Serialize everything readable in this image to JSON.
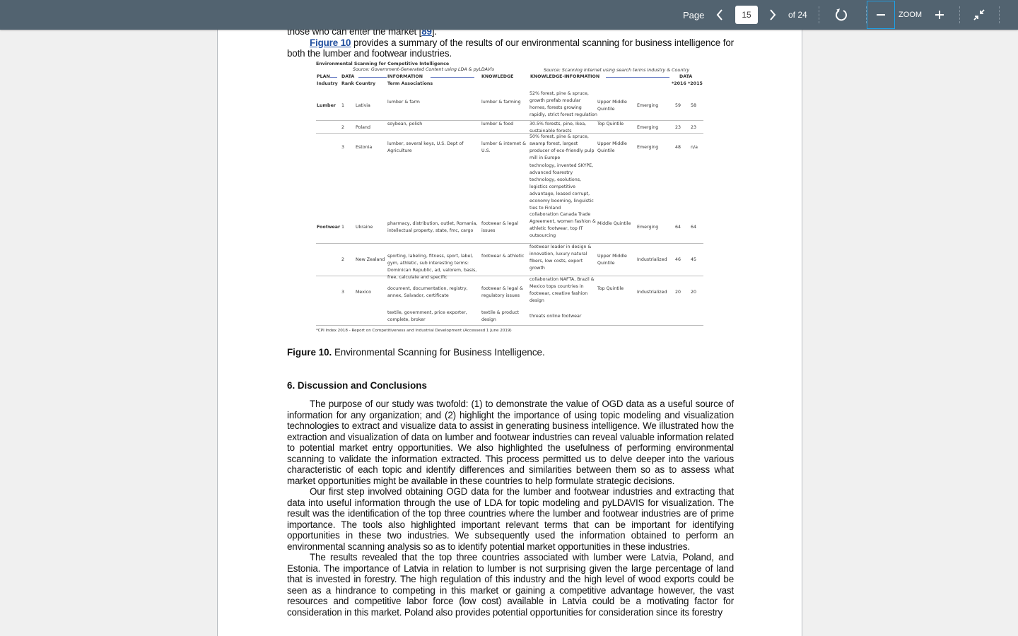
{
  "toolbar": {
    "page_label": "Page",
    "current_page": "15",
    "total_pages": "of 24",
    "zoom_label": "ZOOM",
    "icons": {
      "prev": "chevron-left-icon",
      "next": "chevron-right-icon",
      "rotate": "rotate-icon",
      "zoom_out": "minus-icon",
      "zoom_in": "plus-icon",
      "fit": "collapse-icon"
    },
    "colors": {
      "bar": "#526370",
      "focus": "#1ea0e6"
    }
  },
  "document": {
    "intro_line_pre": "those who can enter the market [",
    "intro_cite": "89",
    "intro_line_post": "].",
    "fig_ref_link": "Figure 10",
    "fig_ref_text": " provides a summary of the results of our environmental scanning for business intelligence for both the lumber and footwear industries.",
    "figure": {
      "title": "Environmental Scanning for Competitive Intelligence",
      "source_left": "Source:  Government-Generated Content using LDA & pyLDAVis",
      "source_right": "Source:  Scanning internet using search terms Industry & Country",
      "flow": {
        "plan": "PLAN",
        "data": "DATA",
        "information": "INFORMATION",
        "knowledge": "KNOWLEDGE",
        "knowledge_information": "KNOWLEDGE-INFORMATION",
        "data_right": "DATA"
      },
      "headers": {
        "industry": "Industry",
        "rank": "Rank",
        "country": "Country",
        "terms": "Term Associations",
        "years": "*2016 *2015"
      },
      "rows": [
        {
          "industry": "Lumber",
          "rank": "1",
          "country": "Lativia",
          "terms": "lumber & farm",
          "knowledge": "lumber & farming",
          "info": "52% forest, pine & spruce, growth prefab modular homes, forests growing rapidly, strict forest regulation",
          "quintile": "Upper Middle Quintile",
          "stage": "Emerging",
          "d2016": "59",
          "d2015": "58"
        },
        {
          "industry": "",
          "rank": "2",
          "country": "Poland",
          "terms": "soybean, polish",
          "knowledge": "lumber & food",
          "info": "30.5% forests, pine, Ikea, sustainable forests",
          "quintile": "Top Quintile",
          "stage": "Emerging",
          "d2016": "23",
          "d2015": "23"
        },
        {
          "industry": "",
          "rank": "3",
          "country": "Estonia",
          "terms": "lumber, several keys, U.S. Dept of Agriculture",
          "knowledge": "lumber & internet & U.S.",
          "info": "50% forest, pine & spruce, swamp forest, largest producer of eco-friendly pulp mill in Europe",
          "info2": "technology, invented SKYPE, advanced foarestry technology, esolutions, logistics competitive advantage, leased corrupt, economy booming, linguistic ties to Finland",
          "quintile": "Upper Middle Quintile",
          "stage": "Emerging",
          "d2016": "48",
          "d2015": "n/a"
        },
        {
          "industry": "Footwear",
          "rank": "1",
          "country": "Ukraine",
          "terms": "pharmacy, distribution, outlet, Romania, intellectual property, state, fmc, cargo",
          "knowledge": "footwear & legal issues",
          "info": "collaboration Canada Trade Agreement, women fashion & athletic footwear, top IT outsourcing",
          "quintile": "Middle Quintile",
          "stage": "Emerging",
          "d2016": "64",
          "d2015": "64"
        },
        {
          "industry": "",
          "rank": "2",
          "country": "New Zealand",
          "terms": "sporting, labeling, fitness, sport, label, gym, athletic, sub interesting terms: Dominican Republic, ad, valorem, basis, free, calculate and specific",
          "knowledge": "footwear & athletic",
          "info": "footwear leader in design & innovation, luxury natural fibers, low costs, export growth",
          "quintile": "Upper Middle Quintile",
          "stage": "Industrialized",
          "d2016": "46",
          "d2015": "45"
        },
        {
          "industry": "",
          "rank": "3",
          "country": "Mexico",
          "terms": "document, documentation, registry, annex, Salvador, certificate",
          "knowledge": "footwear & legal & regulatory issues",
          "info": "collaboration NAFTA, Brazil & Mexico tops countries in footwear, creative fashion design",
          "quintile": "Top Quintile",
          "stage": "Industrialized",
          "d2016": "20",
          "d2015": "20"
        },
        {
          "industry": "",
          "rank": "",
          "country": "",
          "terms": "textile, government, price exporter, complete, broker",
          "knowledge": "textile & product design",
          "info": "threats online footwear",
          "quintile": "",
          "stage": "",
          "d2016": "",
          "d2015": ""
        }
      ],
      "footnote": "*CPI Index 2018 - Report on Competitiveness and Industrial Development (Accessesd 1 June 2019)"
    },
    "caption_label": "Figure 10.",
    "caption_text": " Environmental Scanning for Business Intelligence.",
    "section_title": "6. Discussion and Conclusions",
    "paragraphs": [
      "The purpose of our study was twofold: (1) to demonstrate the value of OGD data as a useful source of information for any organization; and (2) highlight the importance of using topic modeling and visualization technologies to extract and visualize data to assist in generating business intelligence. We illustrated how the extraction and visualization of data on lumber and footwear industries can reveal valuable information related to potential market entry opportunities. We also highlighted the usefulness of performing environmental scanning to validate the information extracted. This process permitted us to delve deeper into the various characteristic of each topic and identify differences and similarities between them so as to assess what market opportunities might be available in these countries to help formulate strategic decisions.",
      "Our first step involved obtaining OGD data for the lumber and footwear industries and extracting that data into useful information through the use of LDA for topic modeling and pyLDAVIS for visualization. The result was the identification of the top three countries where the lumber and footwear industries are of prime importance. The tools also highlighted important relevant terms that can be important for identifying opportunities in these two industries. We subsequently used the information obtained to perform an environmental scanning analysis so as to identify potential market opportunities in these industries.",
      "The results revealed that the top three countries associated with lumber were Latvia, Poland, and Estonia. The importance of Latvia in relation to lumber is not surprising given the large percentage of land that is invested in forestry. The high regulation of this industry and the high level of wood exports could be seen as a hindrance to competing in this market or gaining a competitive advantage however, the vast resources and competitive labor force (low cost) available in Latvia could be a motivating factor for consideration in this market. Poland also provides potential opportunities for consideration since its forestry"
    ]
  }
}
